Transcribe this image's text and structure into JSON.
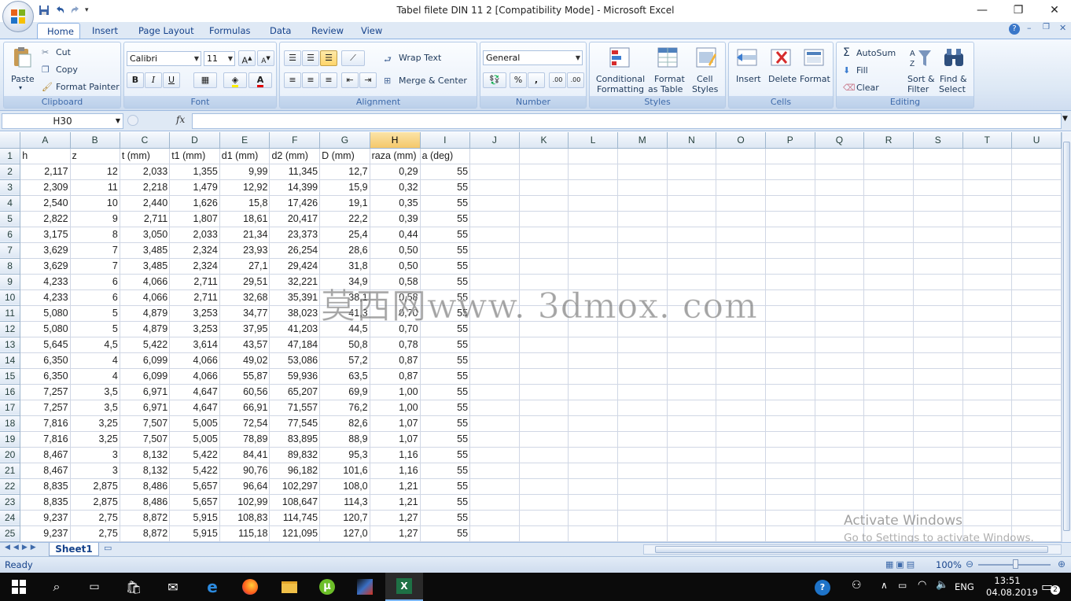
{
  "window": {
    "title": "Tabel filete DIN 11 2  [Compatibility Mode] - Microsoft Excel",
    "controls": [
      "—",
      "❐",
      "✕"
    ]
  },
  "ribbon_tabs": [
    "Home",
    "Insert",
    "Page Layout",
    "Formulas",
    "Data",
    "Review",
    "View"
  ],
  "active_tab": "Home",
  "clipboard": {
    "paste": "Paste",
    "cut": "Cut",
    "copy": "Copy",
    "format_painter": "Format Painter",
    "group": "Clipboard"
  },
  "font": {
    "name": "Calibri",
    "size": "11",
    "bold": "B",
    "italic": "I",
    "underline": "U",
    "group": "Font"
  },
  "alignment": {
    "wrap_text": "Wrap Text",
    "merge_center": "Merge & Center",
    "group": "Alignment"
  },
  "number": {
    "format": "General",
    "percent": "%",
    "comma": ",",
    "inc_dec": ".00",
    "group": "Number"
  },
  "styles": {
    "conditional_1": "Conditional",
    "conditional_2": "Formatting",
    "table_1": "Format",
    "table_2": "as Table",
    "cell_1": "Cell",
    "cell_2": "Styles",
    "group": "Styles"
  },
  "cells": {
    "insert": "Insert",
    "delete": "Delete",
    "format": "Format",
    "group": "Cells"
  },
  "editing": {
    "autosum": "AutoSum",
    "fill": "Fill",
    "clear": "Clear",
    "sort_1": "Sort &",
    "sort_2": "Filter",
    "find_1": "Find &",
    "find_2": "Select",
    "group": "Editing"
  },
  "formula_bar": {
    "name_box": "H30",
    "fx": "fx",
    "formula": ""
  },
  "columns": [
    "A",
    "B",
    "C",
    "D",
    "E",
    "F",
    "G",
    "H",
    "I",
    "J",
    "K",
    "L",
    "M",
    "N",
    "O",
    "P",
    "Q",
    "R",
    "S",
    "T",
    "U"
  ],
  "selected_column": "H",
  "headers": [
    "h",
    "z",
    "t (mm)",
    "t1 (mm)",
    "d1 (mm)",
    "d2 (mm)",
    "D (mm)",
    "raza (mm)",
    "a (deg)"
  ],
  "rows": [
    [
      "2,117",
      "12",
      "2,033",
      "1,355",
      "9,99",
      "11,345",
      "12,7",
      "0,29",
      "55"
    ],
    [
      "2,309",
      "11",
      "2,218",
      "1,479",
      "12,92",
      "14,399",
      "15,9",
      "0,32",
      "55"
    ],
    [
      "2,540",
      "10",
      "2,440",
      "1,626",
      "15,8",
      "17,426",
      "19,1",
      "0,35",
      "55"
    ],
    [
      "2,822",
      "9",
      "2,711",
      "1,807",
      "18,61",
      "20,417",
      "22,2",
      "0,39",
      "55"
    ],
    [
      "3,175",
      "8",
      "3,050",
      "2,033",
      "21,34",
      "23,373",
      "25,4",
      "0,44",
      "55"
    ],
    [
      "3,629",
      "7",
      "3,485",
      "2,324",
      "23,93",
      "26,254",
      "28,6",
      "0,50",
      "55"
    ],
    [
      "3,629",
      "7",
      "3,485",
      "2,324",
      "27,1",
      "29,424",
      "31,8",
      "0,50",
      "55"
    ],
    [
      "4,233",
      "6",
      "4,066",
      "2,711",
      "29,51",
      "32,221",
      "34,9",
      "0,58",
      "55"
    ],
    [
      "4,233",
      "6",
      "4,066",
      "2,711",
      "32,68",
      "35,391",
      "38,1",
      "0,58",
      "55"
    ],
    [
      "5,080",
      "5",
      "4,879",
      "3,253",
      "34,77",
      "38,023",
      "41,3",
      "0,70",
      "55"
    ],
    [
      "5,080",
      "5",
      "4,879",
      "3,253",
      "37,95",
      "41,203",
      "44,5",
      "0,70",
      "55"
    ],
    [
      "5,645",
      "4,5",
      "5,422",
      "3,614",
      "43,57",
      "47,184",
      "50,8",
      "0,78",
      "55"
    ],
    [
      "6,350",
      "4",
      "6,099",
      "4,066",
      "49,02",
      "53,086",
      "57,2",
      "0,87",
      "55"
    ],
    [
      "6,350",
      "4",
      "6,099",
      "4,066",
      "55,87",
      "59,936",
      "63,5",
      "0,87",
      "55"
    ],
    [
      "7,257",
      "3,5",
      "6,971",
      "4,647",
      "60,56",
      "65,207",
      "69,9",
      "1,00",
      "55"
    ],
    [
      "7,257",
      "3,5",
      "6,971",
      "4,647",
      "66,91",
      "71,557",
      "76,2",
      "1,00",
      "55"
    ],
    [
      "7,816",
      "3,25",
      "7,507",
      "5,005",
      "72,54",
      "77,545",
      "82,6",
      "1,07",
      "55"
    ],
    [
      "7,816",
      "3,25",
      "7,507",
      "5,005",
      "78,89",
      "83,895",
      "88,9",
      "1,07",
      "55"
    ],
    [
      "8,467",
      "3",
      "8,132",
      "5,422",
      "84,41",
      "89,832",
      "95,3",
      "1,16",
      "55"
    ],
    [
      "8,467",
      "3",
      "8,132",
      "5,422",
      "90,76",
      "96,182",
      "101,6",
      "1,16",
      "55"
    ],
    [
      "8,835",
      "2,875",
      "8,486",
      "5,657",
      "96,64",
      "102,297",
      "108,0",
      "1,21",
      "55"
    ],
    [
      "8,835",
      "2,875",
      "8,486",
      "5,657",
      "102,99",
      "108,647",
      "114,3",
      "1,21",
      "55"
    ],
    [
      "9,237",
      "2,75",
      "8,872",
      "5,915",
      "108,83",
      "114,745",
      "120,7",
      "1,27",
      "55"
    ],
    [
      "9,237",
      "2,75",
      "8,872",
      "5,915",
      "115,18",
      "121,095",
      "127,0",
      "1,27",
      "55"
    ]
  ],
  "sheet_tab": "Sheet1",
  "status": {
    "ready": "Ready",
    "zoom": "100%"
  },
  "watermark": "莫西网www. 3dmox. com",
  "activation": {
    "line1": "Activate Windows",
    "line2": "Go to Settings to activate Windows."
  },
  "taskbar": {
    "lang": "ENG",
    "time": "13:51",
    "date": "04.08.2019",
    "notifications": "2"
  },
  "colors": {
    "accent": "#15428b",
    "ribbon": "#dfe9f5",
    "selected_header": "#f4c86a"
  }
}
